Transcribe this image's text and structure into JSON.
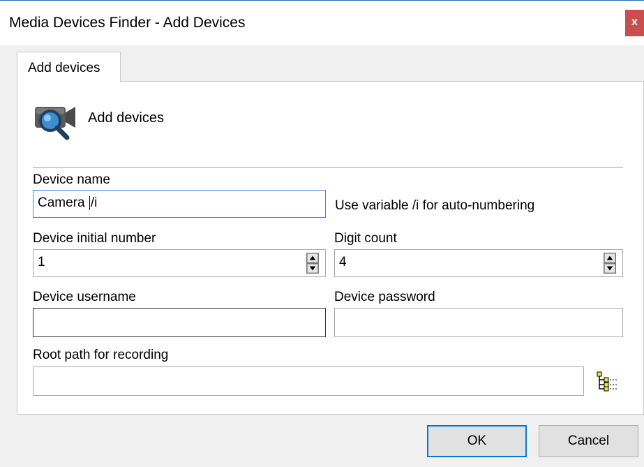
{
  "window": {
    "title": "Media Devices Finder - Add Devices",
    "close_glyph": "x"
  },
  "tab": {
    "label": "Add devices"
  },
  "header": {
    "title": "Add devices",
    "icon": "camera-search-icon"
  },
  "form": {
    "device_name": {
      "label": "Device name",
      "value_before_caret": "Camera ",
      "value_after_caret": "/i",
      "hint": "Use variable /i for auto-numbering"
    },
    "initial_number": {
      "label": "Device initial number",
      "value": "1"
    },
    "digit_count": {
      "label": "Digit count",
      "value": "4"
    },
    "username": {
      "label": "Device username",
      "value": ""
    },
    "password": {
      "label": "Device password",
      "value": ""
    },
    "root_path": {
      "label": "Root path for recording",
      "value": "",
      "browse_icon": "folder-tree-icon"
    }
  },
  "buttons": {
    "ok": "OK",
    "cancel": "Cancel"
  },
  "colors": {
    "accent": "#0078d7",
    "close": "#c94f4f",
    "focus": "#3d86d6"
  }
}
